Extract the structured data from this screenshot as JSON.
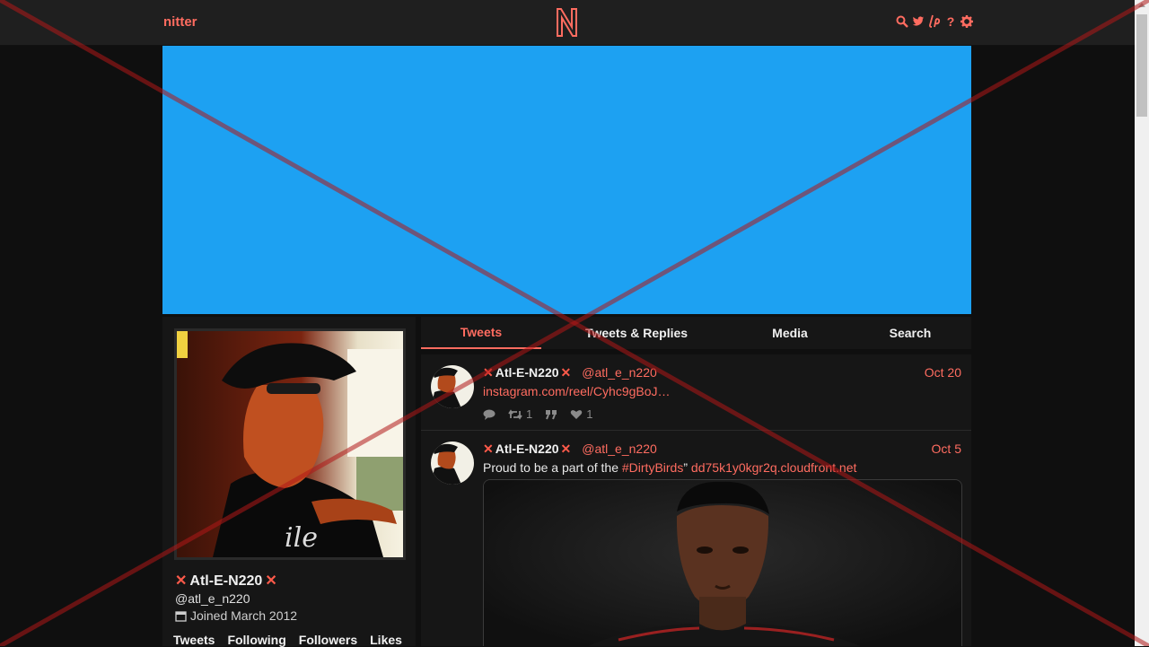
{
  "navbar": {
    "brand": "nitter"
  },
  "profile": {
    "name": "Atl-E-N220",
    "handle": "@atl_e_n220",
    "joined": "Joined March 2012",
    "stats": [
      "Tweets",
      "Following",
      "Followers",
      "Likes"
    ]
  },
  "tabs": [
    "Tweets",
    "Tweets & Replies",
    "Media",
    "Search"
  ],
  "tweets": [
    {
      "name": "Atl-E-N220",
      "handle": "@atl_e_n220",
      "date": "Oct 20",
      "link": "instagram.com/reel/Cyhc9gBoJ…",
      "retweets": "1",
      "likes": "1"
    },
    {
      "name": "Atl-E-N220",
      "handle": "@atl_e_n220",
      "date": "Oct 5",
      "text_before": "Proud to be a part of the ",
      "hashtag": "#DirtyBirds",
      "text_after": "” ",
      "link": "dd75k1y0kgr2q.cloudfront.net"
    }
  ],
  "colors": {
    "accent": "#ff6c60",
    "banner": "#1da1f2",
    "background": "#0f0f0f"
  },
  "icons": [
    "search-icon",
    "twitter-bird-icon",
    "liberapay-icon",
    "help-icon",
    "gear-icon",
    "calendar-icon",
    "comment-icon",
    "retweet-icon",
    "quote-icon",
    "heart-icon"
  ]
}
